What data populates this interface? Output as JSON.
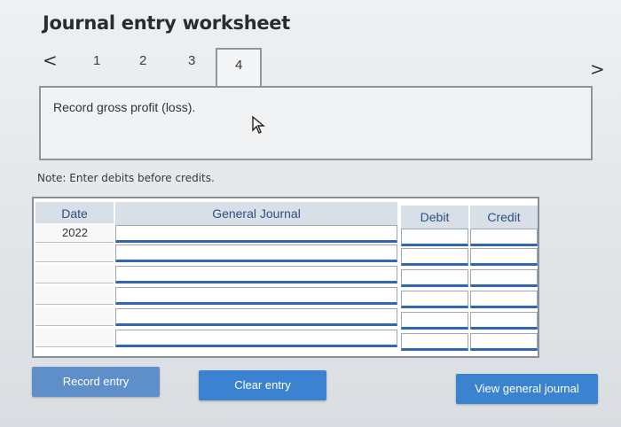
{
  "header": {
    "title": "Journal entry worksheet"
  },
  "nav": {
    "prev_symbol": "<",
    "next_symbol": ">",
    "tabs": [
      {
        "label": "1"
      },
      {
        "label": "2"
      },
      {
        "label": "3"
      },
      {
        "label": "4",
        "active": true
      }
    ]
  },
  "instruction": {
    "text": "Record gross profit (loss)."
  },
  "note": {
    "text": "Note: Enter debits before credits."
  },
  "journal": {
    "columns": {
      "date": "Date",
      "general_journal": "General Journal",
      "debit": "Debit",
      "credit": "Credit"
    },
    "rows": [
      {
        "date": "2022",
        "account": "",
        "debit": "",
        "credit": ""
      },
      {
        "date": "",
        "account": "",
        "debit": "",
        "credit": ""
      },
      {
        "date": "",
        "account": "",
        "debit": "",
        "credit": ""
      },
      {
        "date": "",
        "account": "",
        "debit": "",
        "credit": ""
      },
      {
        "date": "",
        "account": "",
        "debit": "",
        "credit": ""
      },
      {
        "date": "",
        "account": "",
        "debit": "",
        "credit": ""
      }
    ]
  },
  "buttons": {
    "record": "Record entry",
    "clear": "Clear entry",
    "view_journal": "View general journal"
  },
  "colors": {
    "button_blue": "#3b82d0",
    "header_text": "#2a4f85",
    "input_underline": "#2f67b2"
  }
}
